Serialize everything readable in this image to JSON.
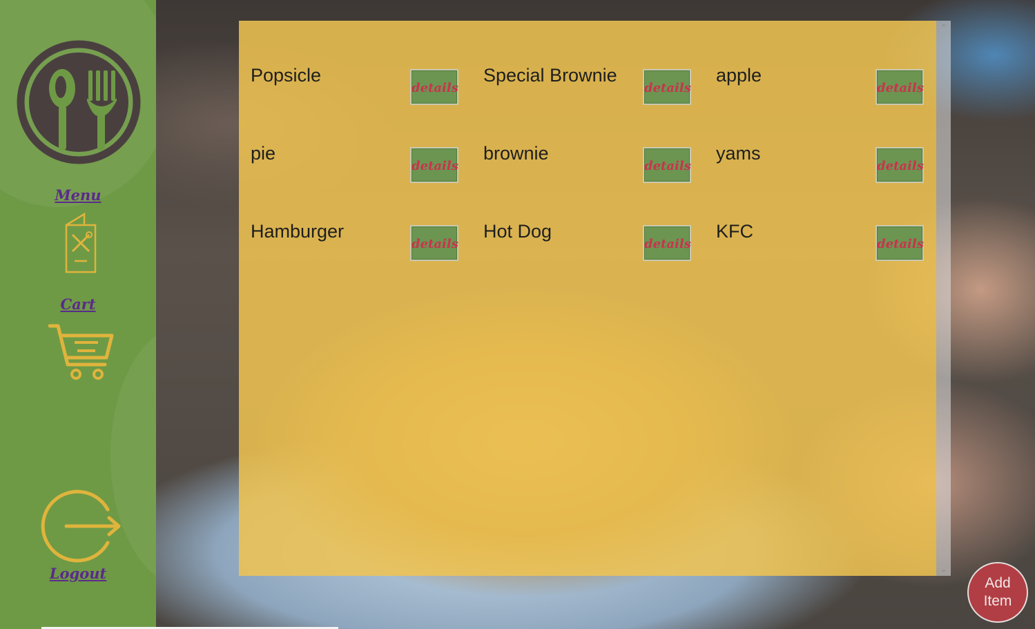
{
  "sidebar": {
    "menu_label": "Menu",
    "cart_label": "Cart",
    "logout_label": "Logout"
  },
  "items": [
    {
      "name": "Popsicle",
      "button": "details"
    },
    {
      "name": "Special Brownie",
      "button": "details"
    },
    {
      "name": "apple",
      "button": "details"
    },
    {
      "name": "pie",
      "button": "details"
    },
    {
      "name": "brownie",
      "button": "details"
    },
    {
      "name": "yams",
      "button": "details"
    },
    {
      "name": "Hamburger",
      "button": "details"
    },
    {
      "name": "Hot Dog",
      "button": "details"
    },
    {
      "name": "KFC",
      "button": "details"
    }
  ],
  "add_item": {
    "line1": "Add",
    "line2": "Item"
  },
  "colors": {
    "sidebar": "#6e9a46",
    "panel": "#f0c452",
    "icon_gold": "#e0b43c",
    "logo_dark": "#4a3f3f",
    "link": "#5b2a8a",
    "details_text": "#c8344c",
    "add_button": "#b13e44"
  },
  "icons": [
    "plate-spoon-fork-logo",
    "menu-booklet-icon",
    "cart-icon",
    "logout-icon",
    "scroll-up-arrow",
    "scroll-down-arrow"
  ]
}
